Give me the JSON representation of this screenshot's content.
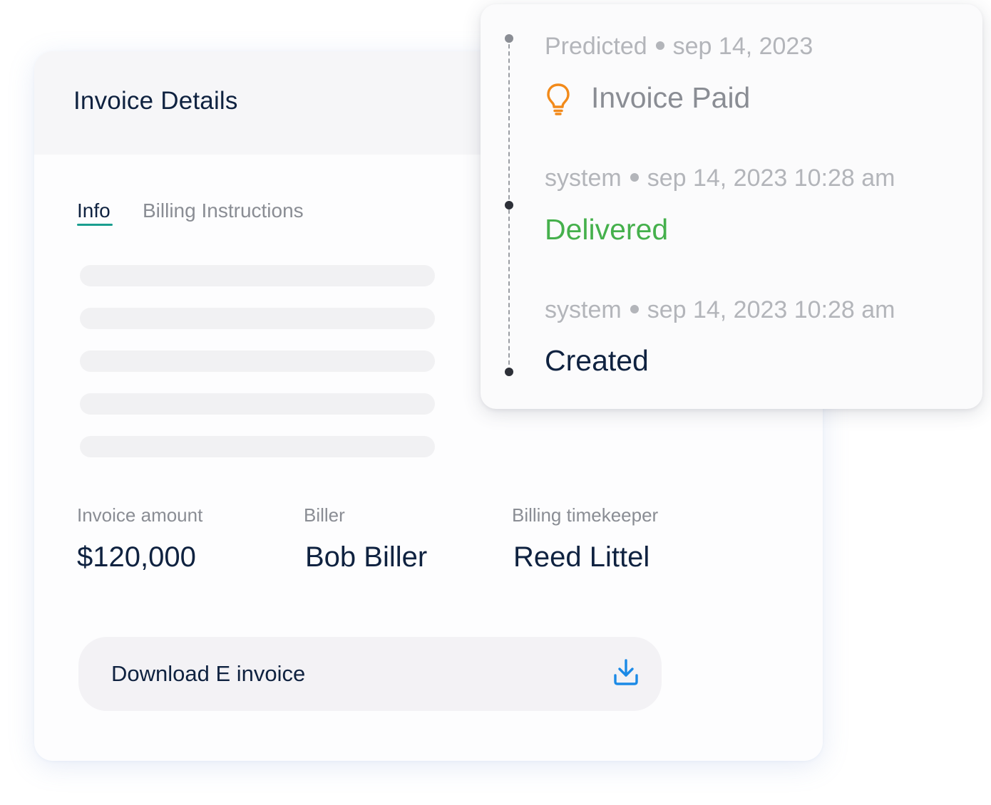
{
  "card": {
    "title": "Invoice Details",
    "tabs": [
      {
        "label": "Info",
        "active": true
      },
      {
        "label": "Billing Instructions",
        "active": false
      }
    ],
    "skeleton_lines": 5,
    "fields": [
      {
        "label": "Invoice amount",
        "value": "$120,000"
      },
      {
        "label": "Biller",
        "value": "Bob Biller"
      },
      {
        "label": "Billing timekeeper",
        "value": "Reed Littel"
      }
    ],
    "download": {
      "label": "Download E invoice",
      "icon": "download-icon"
    }
  },
  "timeline": {
    "events": [
      {
        "source": "Predicted",
        "timestamp": "sep 14, 2023",
        "event": "Invoice Paid",
        "icon": "lightbulb-icon",
        "color": "#8a8d94"
      },
      {
        "source": "system",
        "timestamp": "sep 14, 2023 10:28 am",
        "event": "Delivered",
        "color": "#45b04c"
      },
      {
        "source": "system",
        "timestamp": "sep 14, 2023 10:28 am",
        "event": "Created",
        "color": "#0f2240"
      }
    ]
  },
  "colors": {
    "title_text": "#0f2240",
    "muted_text": "#8a8d94",
    "tab_underline": "#1a9e8f",
    "delivered_green": "#45b04c",
    "bulb_orange": "#f28a1a",
    "download_blue": "#1b8ae6"
  }
}
